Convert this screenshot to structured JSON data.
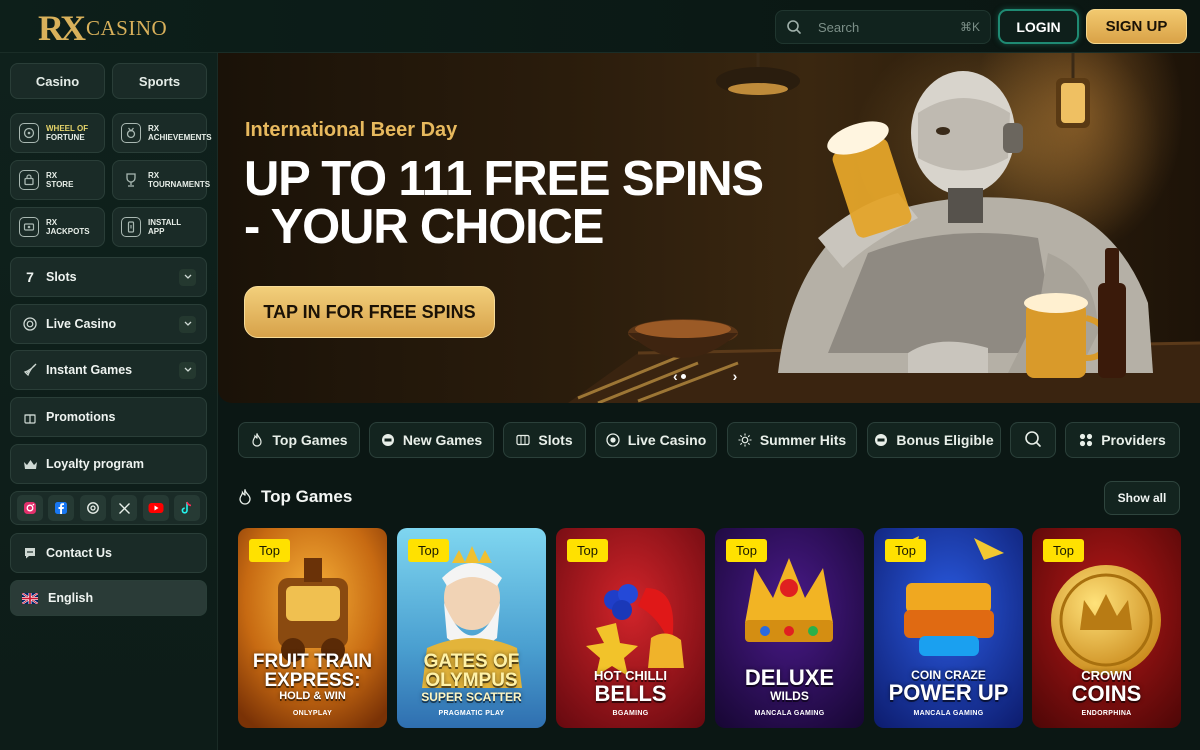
{
  "header": {
    "logo_mark": "RX",
    "logo_text": "CASINO",
    "search_placeholder": "Search",
    "search_shortcut": "⌘K",
    "login_label": "LOGIN",
    "signup_label": "SIGN UP"
  },
  "sidebar": {
    "toggle": [
      "Casino",
      "Sports"
    ],
    "tiles": [
      {
        "line1": "WHEEL OF",
        "line2": "FORTUNE",
        "icon": "wheel-icon"
      },
      {
        "line1": "RX",
        "line2": "ACHIEVEMENTS",
        "icon": "medal-icon"
      },
      {
        "line1": "RX",
        "line2": "STORE",
        "icon": "store-icon"
      },
      {
        "line1": "RX",
        "line2": "TOURNAMENTS",
        "icon": "trophy-icon"
      },
      {
        "line1": "RX",
        "line2": "JACKPOTS",
        "icon": "jackpot-icon"
      },
      {
        "line1": "INSTALL",
        "line2": "APP",
        "icon": "phone-icon"
      }
    ],
    "menu": [
      {
        "label": "Slots",
        "icon": "seven-icon",
        "expandable": true
      },
      {
        "label": "Live Casino",
        "icon": "chip-icon",
        "expandable": true
      },
      {
        "label": "Instant Games",
        "icon": "rocket-icon",
        "expandable": true
      },
      {
        "label": "Promotions",
        "icon": "gift-icon",
        "expandable": false
      },
      {
        "label": "Loyalty program",
        "icon": "crown-icon",
        "expandable": false
      }
    ],
    "socials": [
      "instagram-icon",
      "facebook-icon",
      "threads-icon",
      "x-icon",
      "youtube-icon",
      "tiktok-icon"
    ],
    "contact_label": "Contact Us",
    "language_label": "English"
  },
  "banner": {
    "subtitle": "International Beer Day",
    "title": "UP TO 111 FREE SPINS - YOUR CHOICE",
    "cta_label": "TAP IN FOR FREE SPINS"
  },
  "categories": [
    {
      "label": "Top Games",
      "icon": "flame-icon"
    },
    {
      "label": "New Games",
      "icon": "new-icon"
    },
    {
      "label": "Slots",
      "icon": "slots-icon"
    },
    {
      "label": "Live Casino",
      "icon": "chip-icon"
    },
    {
      "label": "Summer Hits",
      "icon": "sun-icon"
    },
    {
      "label": "Bonus Eligible",
      "icon": "bonus-icon"
    },
    {
      "label": "",
      "icon": "search-icon"
    },
    {
      "label": "Providers",
      "icon": "grid-icon"
    }
  ],
  "top_games": {
    "title": "Top Games",
    "show_all_label": "Show all",
    "badge_label": "Top",
    "games": [
      {
        "line1": "FRUIT TRAIN",
        "line2": "EXPRESS:",
        "line3": "HOLD & WIN",
        "provider": "ONLYPLAY"
      },
      {
        "line1": "GATES OF",
        "line2": "OLYMPUS",
        "line3": "SUPER SCATTER",
        "provider": "PRAGMATIC PLAY"
      },
      {
        "line1": "HOT CHILLI",
        "line2": "BELLS",
        "line3": "",
        "provider": "BGAMING"
      },
      {
        "line1": "DELUXE",
        "line2": "WILDS",
        "line3": "",
        "provider": "MANCALA GAMING"
      },
      {
        "line1": "COIN CRAZE",
        "line2": "POWER UP",
        "line3": "",
        "provider": "MANCALA GAMING"
      },
      {
        "line1": "CROWN",
        "line2": "COINS",
        "line3": "",
        "provider": "ENDORPHINA"
      }
    ]
  }
}
